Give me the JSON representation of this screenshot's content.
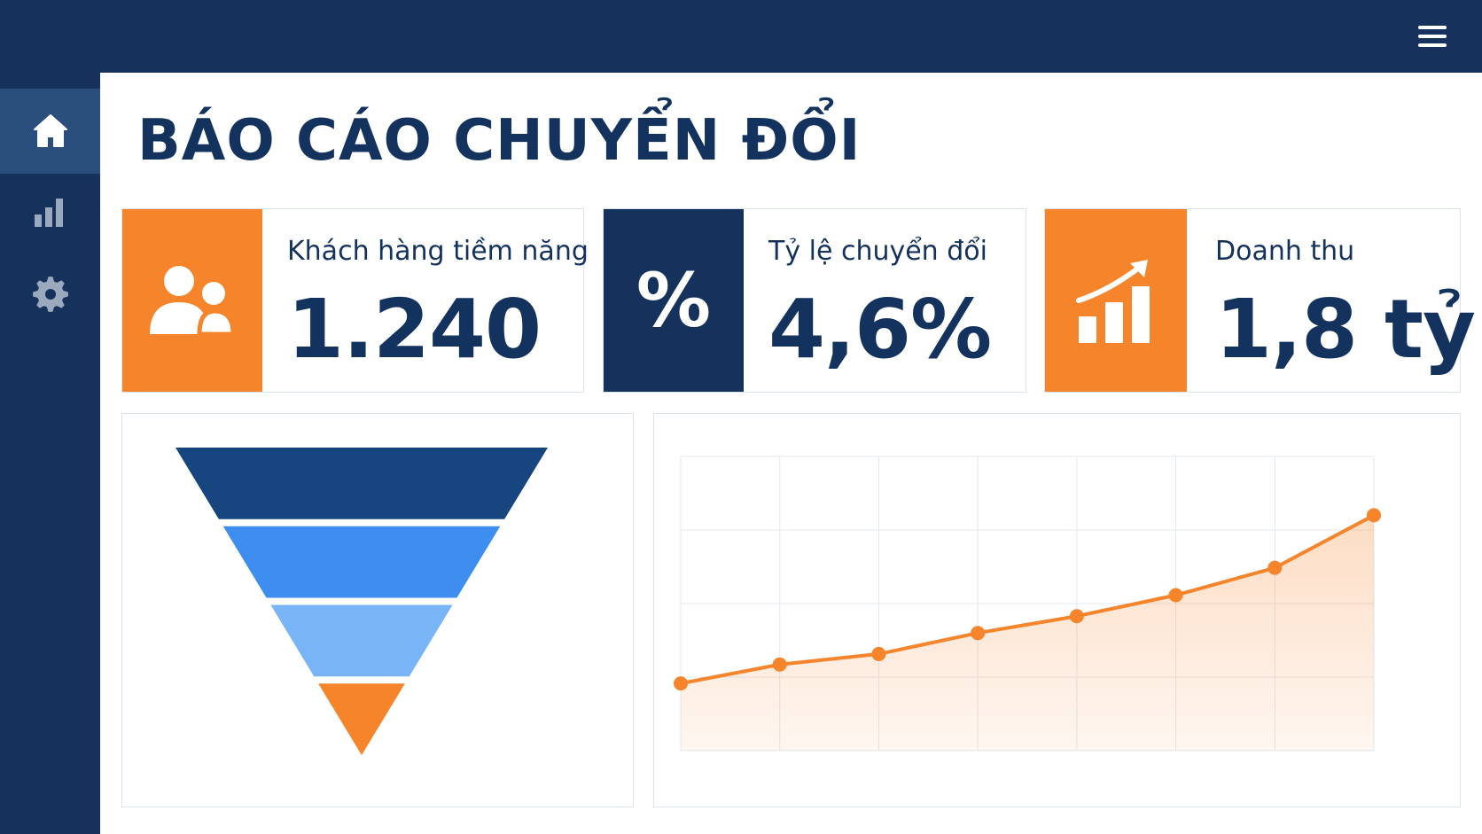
{
  "header": {
    "menu_icon": "hamburger-menu-icon",
    "background": "#14325b"
  },
  "sidebar": {
    "items": [
      {
        "icon": "home-icon",
        "active": true
      },
      {
        "icon": "bar-chart-icon",
        "active": false
      },
      {
        "icon": "gear-icon",
        "active": false
      }
    ]
  },
  "page": {
    "title": "BÁO CÁO CHUYỂN ĐỔI"
  },
  "kpis": [
    {
      "label": "Khách hàng tiềm năng",
      "value": "1.240",
      "icon": "users-icon",
      "icon_bg": "#f6842b"
    },
    {
      "label": "Tỷ lệ chuyển đổi",
      "value": "4,6%",
      "icon": "percent-icon",
      "icon_glyph": "%",
      "icon_bg": "#14325b"
    },
    {
      "label": "Doanh thu",
      "value": "1,8 tỷ",
      "icon": "growth-chart-icon",
      "icon_bg": "#f6842b"
    }
  ],
  "colors": {
    "navy": "#14325b",
    "orange": "#f6842b",
    "funnel": [
      "#17457f",
      "#3d8eef",
      "#79b4f7",
      "#f6842b"
    ]
  },
  "chart_data": [
    {
      "type": "funnel",
      "stages": 4,
      "relative_widths": [
        1.0,
        0.77,
        0.55,
        0.33
      ]
    },
    {
      "type": "area",
      "x": [
        1,
        2,
        3,
        4,
        5,
        6,
        7,
        8
      ],
      "values": [
        3.2,
        4.1,
        4.6,
        5.6,
        6.4,
        7.4,
        8.7,
        11.2
      ],
      "ylim": [
        0,
        14
      ],
      "grid": true,
      "line_color": "#f6842b"
    }
  ]
}
